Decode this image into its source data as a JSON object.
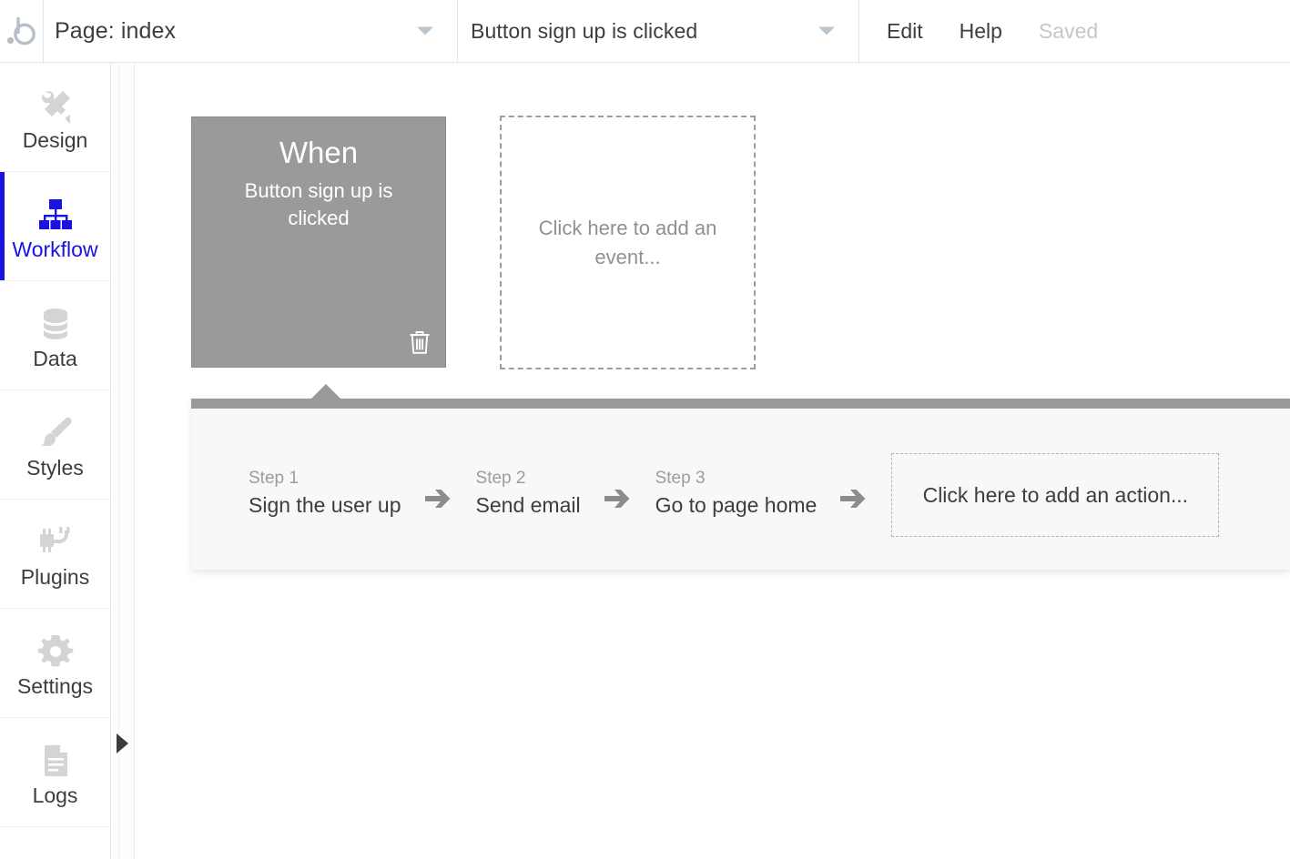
{
  "app": {
    "logo_icon": "bubble-logo-icon"
  },
  "topbar": {
    "page_selector": {
      "label": "Page: index",
      "caret_icon": "chevron-down-icon"
    },
    "event_selector": {
      "label": "Button sign up is clicked",
      "caret_icon": "chevron-down-icon"
    },
    "menu": [
      {
        "label": "Edit",
        "muted": false
      },
      {
        "label": "Help",
        "muted": false
      },
      {
        "label": "Saved",
        "muted": true
      }
    ]
  },
  "sidebar": {
    "items": [
      {
        "label": "Design",
        "icon": "design-tools-icon",
        "active": false
      },
      {
        "label": "Workflow",
        "icon": "workflow-tree-icon",
        "active": true
      },
      {
        "label": "Data",
        "icon": "database-icon",
        "active": false
      },
      {
        "label": "Styles",
        "icon": "paintbrush-icon",
        "active": false
      },
      {
        "label": "Plugins",
        "icon": "plug-icon",
        "active": false
      },
      {
        "label": "Settings",
        "icon": "gear-icon",
        "active": false
      },
      {
        "label": "Logs",
        "icon": "document-icon",
        "active": false
      }
    ],
    "panel_toggle_icon": "expand-panel-arrow-icon"
  },
  "canvas": {
    "event_card": {
      "title": "When",
      "subtitle": "Button sign up is clicked",
      "delete_icon": "trash-icon"
    },
    "add_event_card": {
      "label": "Click here to add an event..."
    },
    "steps": [
      {
        "number": "Step 1",
        "name": "Sign the user up"
      },
      {
        "number": "Step 2",
        "name": "Send email"
      },
      {
        "number": "Step 3",
        "name": "Go to page home"
      }
    ],
    "step_arrow_icon": "arrow-right-icon",
    "add_action": {
      "label": "Click here to add an action..."
    }
  },
  "colors": {
    "accent": "#1a12e0",
    "event_card_bg": "#9a9a9a",
    "panel_bg": "#f8f8f8",
    "muted_text": "#9a9da0"
  }
}
